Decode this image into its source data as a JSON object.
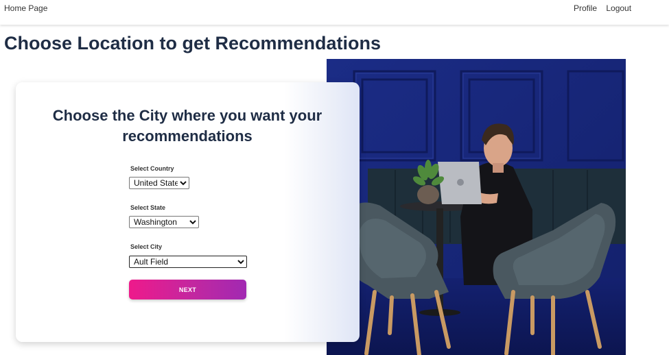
{
  "nav": {
    "home": "Home Page",
    "profile": "Profile",
    "logout": "Logout"
  },
  "page": {
    "title": "Choose Location to get Recommendations"
  },
  "card": {
    "title": "Choose the City where you want your recommendations",
    "country": {
      "label": "Select Country",
      "selected": "United States"
    },
    "state": {
      "label": "Select State",
      "selected": "Washington"
    },
    "city": {
      "label": "Select City",
      "selected": "Ault Field"
    },
    "next_label": "NEXT"
  },
  "colors": {
    "title": "#1f2d45",
    "button_start": "#ee1a8b",
    "button_end": "#a129b2",
    "photo_wall": "#1a2a78"
  },
  "image": {
    "description_icon": "person-at-laptop-photo"
  }
}
